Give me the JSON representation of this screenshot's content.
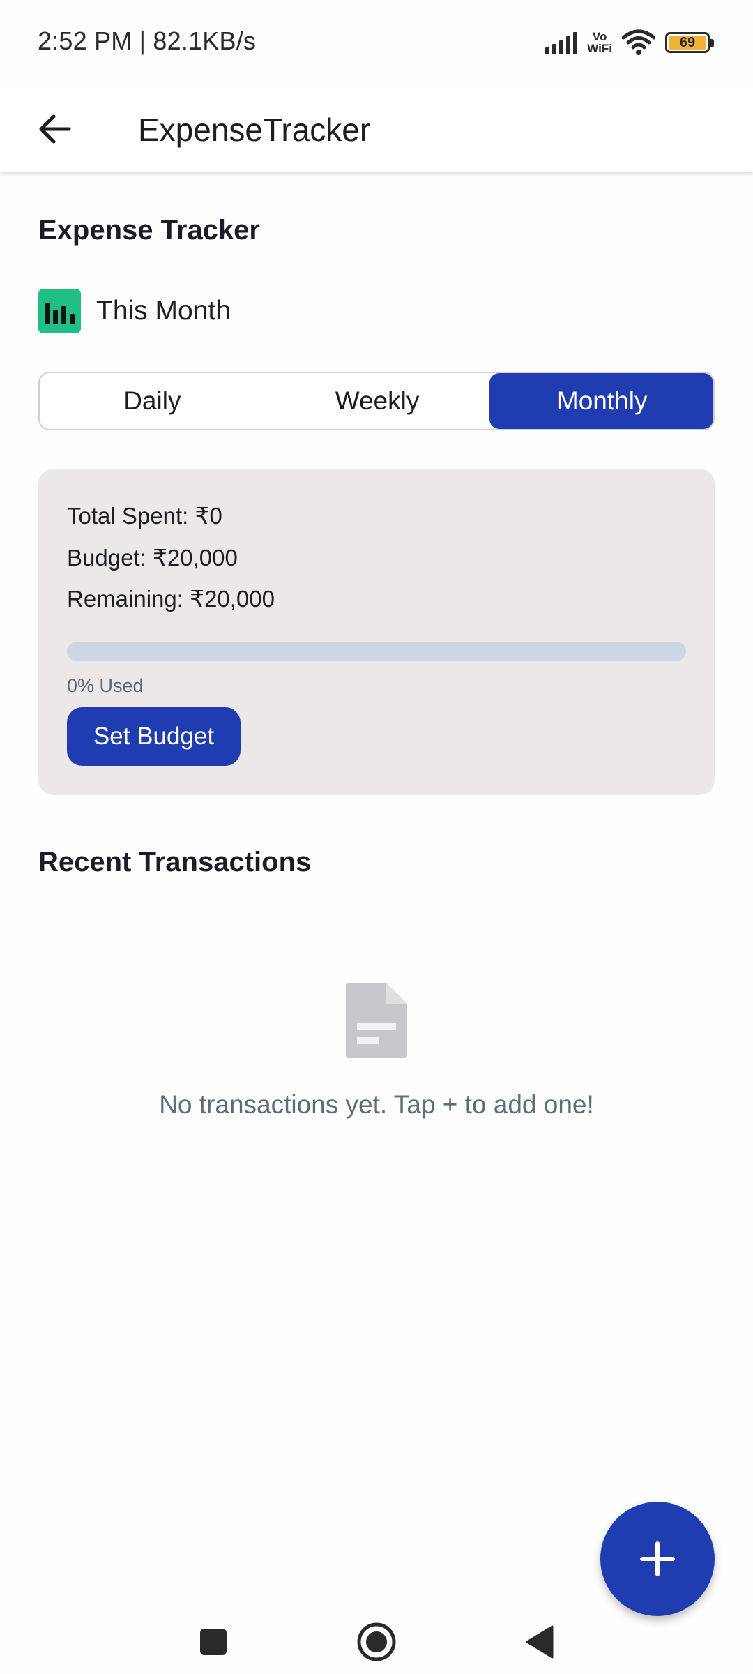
{
  "status_bar": {
    "time_network": "2:52 PM | 82.1KB/s",
    "vowifi_top": "Vo",
    "vowifi_bottom": "WiFi",
    "battery_level": "69"
  },
  "app_bar": {
    "title": "ExpenseTracker",
    "back_icon": "arrow-left-icon"
  },
  "header": {
    "title": "Expense Tracker",
    "period_icon": "bar-chart-icon",
    "period_label": "This Month"
  },
  "period_tabs": {
    "items": [
      {
        "label": "Daily",
        "selected": false
      },
      {
        "label": "Weekly",
        "selected": false
      },
      {
        "label": "Monthly",
        "selected": true
      }
    ]
  },
  "budget_summary": {
    "total_spent": "Total Spent: ₹0",
    "budget": "Budget: ₹20,000",
    "remaining": "Remaining: ₹20,000",
    "used_fraction": 0,
    "used_label": "0% Used",
    "set_budget_label": "Set Budget"
  },
  "transactions": {
    "title": "Recent Transactions",
    "empty_icon": "document-icon",
    "empty_message": "No transactions yet. Tap + to add one!"
  },
  "fab": {
    "icon": "plus-icon"
  },
  "colors": {
    "primary": "#1f3cb0",
    "accent_green": "#1fbf86",
    "card_bg": "#ece8e8",
    "progress_track": "#cdd6e4"
  },
  "nav_bar": {
    "recents_icon": "square-icon",
    "home_icon": "home-circle-icon",
    "back_icon": "triangle-back-icon"
  }
}
